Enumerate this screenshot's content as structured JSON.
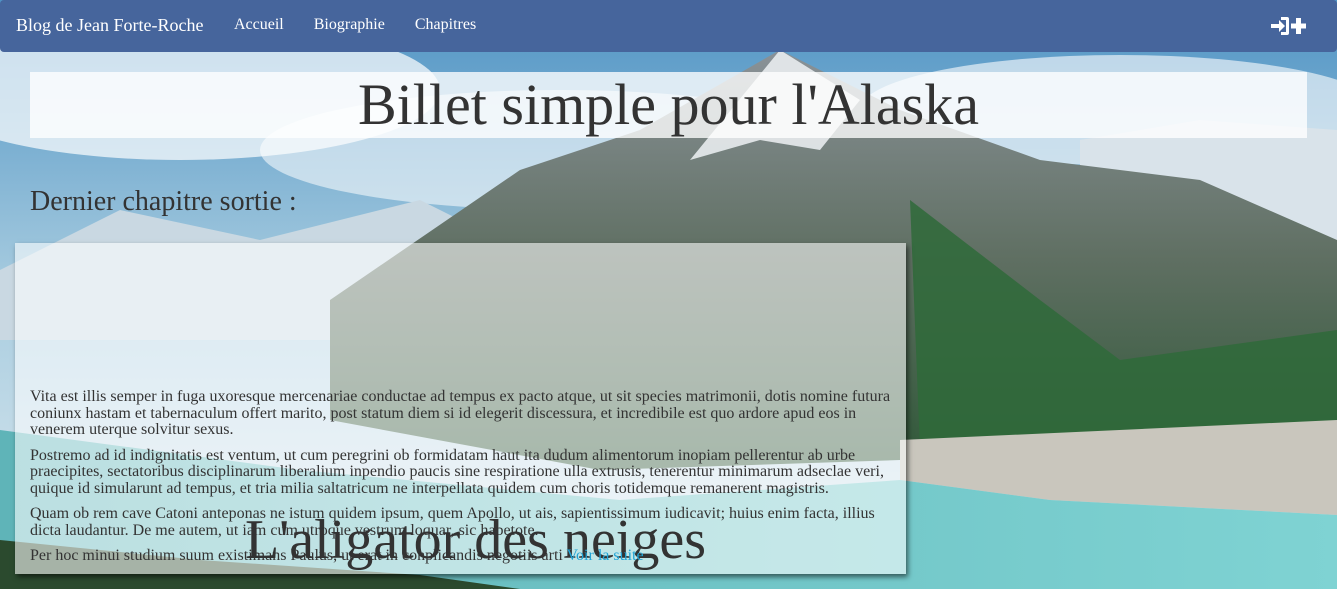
{
  "navbar": {
    "brand": "Blog de Jean Forte-Roche",
    "links": [
      "Accueil",
      "Biographie",
      "Chapitres"
    ],
    "login_icon": "login-user-plus-icon"
  },
  "hero": {
    "title": "Billet simple pour l'Alaska"
  },
  "latest": {
    "label": "Dernier chapitre sortie :"
  },
  "chapter": {
    "title": "L'aligator des neiges",
    "paragraphs": [
      "Vita est illis semper in fuga uxoresque mercenariae conductae ad tempus ex pacto atque, ut sit species matrimonii, dotis nomine futura coniunx hastam et tabernaculum offert marito, post statum diem si id elegerit discessura, et incredibile est quo ardore apud eos in venerem uterque solvitur sexus.",
      "Postremo ad id indignitatis est ventum, ut cum peregrini ob formidatam haut ita dudum alimentorum inopiam pellerentur ab urbe praecipites, sectatoribus disciplinarum liberalium inpendio paucis sine respiratione ulla extrusis, tenerentur minimarum adseclae veri, quique id simularunt ad tempus, et tria milia saltatricum ne interpellata quidem cum choris totidemque remanerent magistris.",
      "Quam ob rem cave Catoni anteponas ne istum quidem ipsum, quem Apollo, ut ais, sapientissimum iudicavit; huius enim facta, illius dicta laudantur. De me autem, ut iam cum utroque vestrum loquar, sic habetote.",
      "Per hoc minui studium suum existimans Paulus, ut erat in conplicandis negotiis arti"
    ],
    "more_link": "Voir la suite"
  },
  "colors": {
    "navbar": "#46659c",
    "link": "#1fa3d6",
    "text": "#333333"
  }
}
